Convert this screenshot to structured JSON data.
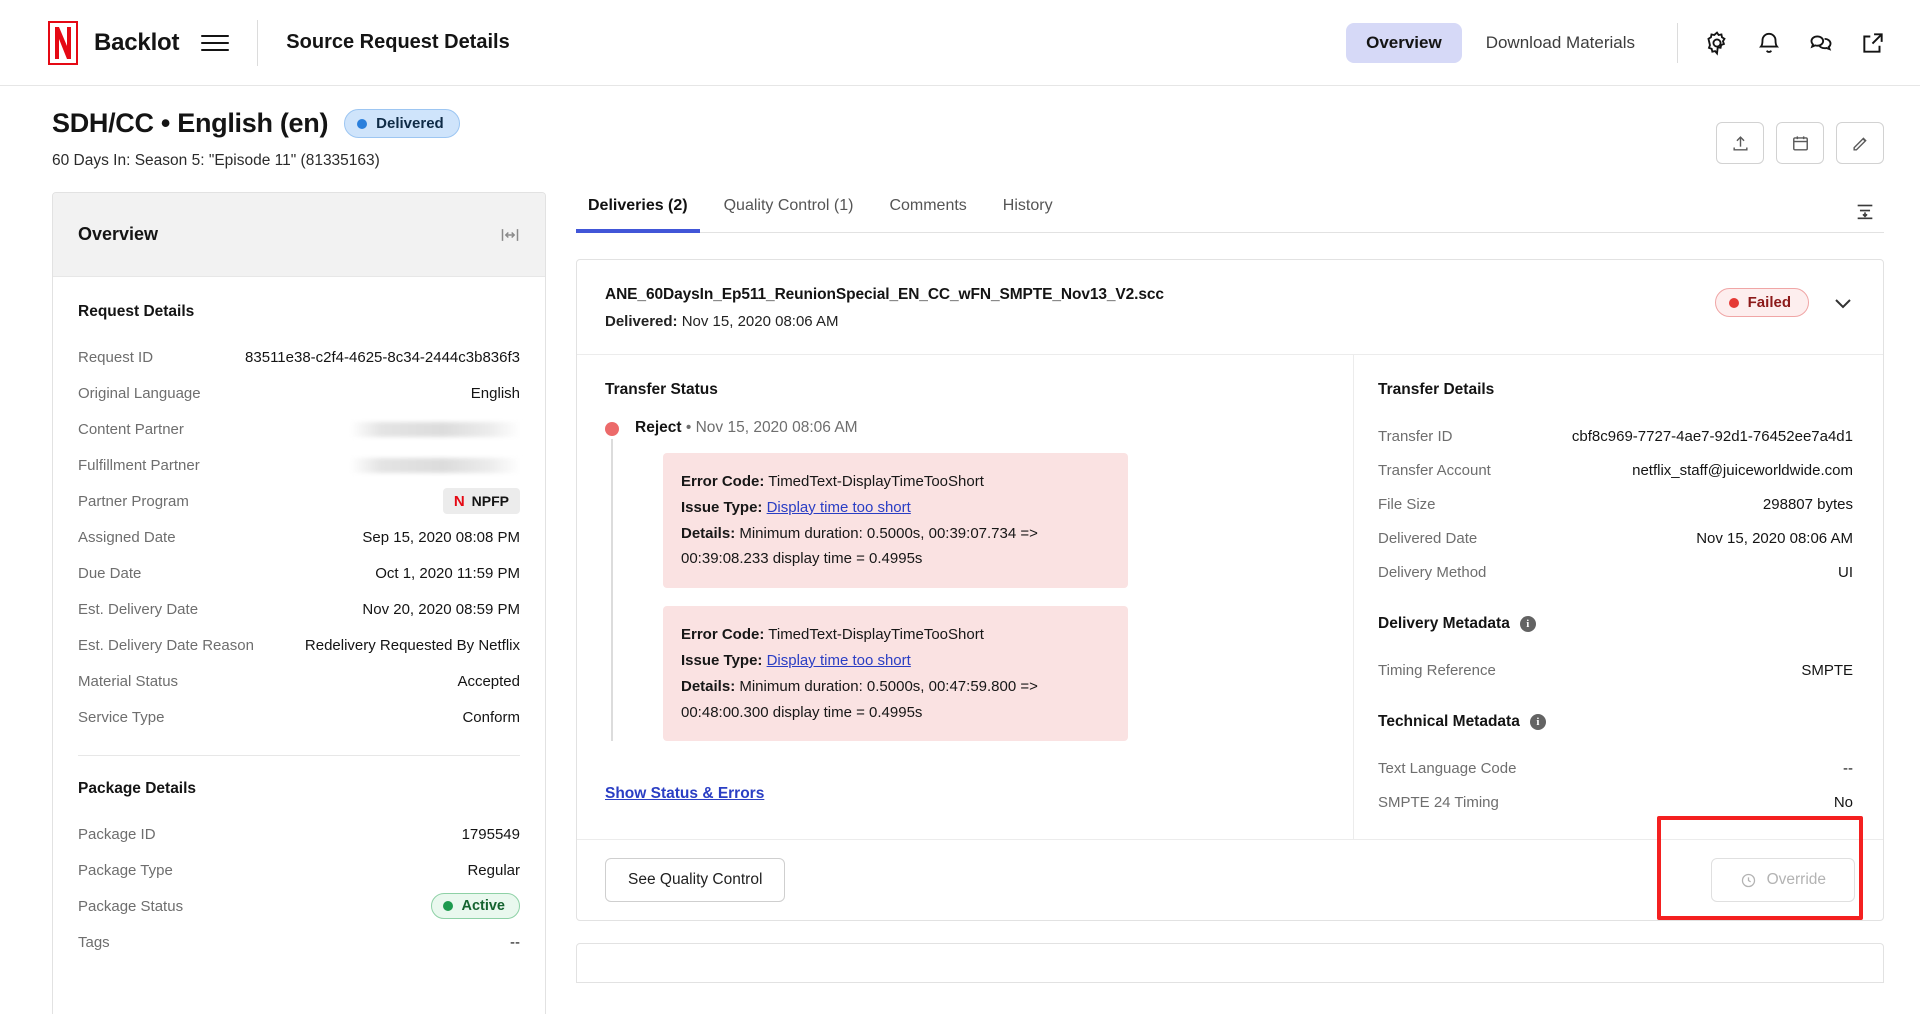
{
  "topnav": {
    "brand": "Backlot",
    "menu_icon": "hamburger-icon",
    "page_context": "Source Request Details",
    "nav_items": [
      {
        "label": "Overview",
        "active": true
      },
      {
        "label": "Download Materials",
        "active": false
      }
    ],
    "icons": [
      "gear-icon",
      "bell-icon",
      "chat-icon",
      "external-link-icon"
    ]
  },
  "page_header": {
    "title": "SDH/CC • English (en)",
    "status_badge": {
      "label": "Delivered",
      "color": "#2a7fdc"
    },
    "subtitle": "60 Days In: Season 5: \"Episode 11\"   (81335163)",
    "actions": [
      "upload-icon",
      "calendar-icon",
      "edit-icon"
    ]
  },
  "sidebar": {
    "header_title": "Overview",
    "collapse_icon": "collapse-panel-icon",
    "request_details": {
      "title": "Request Details",
      "rows": [
        {
          "label": "Request ID",
          "value": "83511e38-c2f4-4625-8c34-2444c3b836f3",
          "type": "text"
        },
        {
          "label": "Original Language",
          "value": "English",
          "type": "text"
        },
        {
          "label": "Content Partner",
          "value": "",
          "type": "redacted"
        },
        {
          "label": "Fulfillment Partner",
          "value": "",
          "type": "redacted"
        },
        {
          "label": "Partner Program",
          "value": "NPFP",
          "type": "chip-npfp"
        },
        {
          "label": "Assigned Date",
          "value": "Sep 15, 2020 08:08 PM",
          "type": "text"
        },
        {
          "label": "Due Date",
          "value": "Oct 1, 2020 11:59 PM",
          "type": "text"
        },
        {
          "label": "Est. Delivery Date",
          "value": "Nov 20, 2020 08:59 PM",
          "type": "text"
        },
        {
          "label": "Est. Delivery Date Reason",
          "value": "Redelivery Requested By Netflix",
          "type": "text"
        },
        {
          "label": "Material Status",
          "value": "Accepted",
          "type": "text"
        },
        {
          "label": "Service Type",
          "value": "Conform",
          "type": "text"
        }
      ]
    },
    "package_details": {
      "title": "Package Details",
      "rows": [
        {
          "label": "Package ID",
          "value": "1795549",
          "type": "text"
        },
        {
          "label": "Package Type",
          "value": "Regular",
          "type": "text"
        },
        {
          "label": "Package Status",
          "value": "Active",
          "type": "badge-active"
        },
        {
          "label": "Tags",
          "value": "--",
          "type": "text"
        }
      ]
    }
  },
  "content": {
    "tabs": [
      {
        "label": "Deliveries (2)",
        "active": true
      },
      {
        "label": "Quality Control (1)",
        "active": false
      },
      {
        "label": "Comments",
        "active": false
      },
      {
        "label": "History",
        "active": false
      }
    ],
    "filter_icon": "filter-sort-icon",
    "delivery_card": {
      "file_name": "ANE_60DaysIn_Ep511_ReunionSpecial_EN_CC_wFN_SMPTE_Nov13_V2.scc",
      "delivered_label": "Delivered:",
      "delivered_value": "Nov 15, 2020 08:06 AM",
      "status_badge": {
        "label": "Failed",
        "color": "#e53935"
      },
      "expand_icon": "chevron-down-icon",
      "transfer_status": {
        "title": "Transfer Status",
        "event_label": "Reject",
        "event_sep": "•",
        "event_time": "Nov 15, 2020 08:06 AM",
        "errors": [
          {
            "error_code_label": "Error Code:",
            "error_code": "TimedText-DisplayTimeTooShort",
            "issue_type_label": "Issue Type:",
            "issue_type": "Display time too short",
            "details_label": "Details:",
            "details": "Minimum duration: 0.5000s, 00:39:07.734 => 00:39:08.233 display time = 0.4995s"
          },
          {
            "error_code_label": "Error Code:",
            "error_code": "TimedText-DisplayTimeTooShort",
            "issue_type_label": "Issue Type:",
            "issue_type": "Display time too short",
            "details_label": "Details:",
            "details": "Minimum duration: 0.5000s, 00:47:59.800 => 00:48:00.300 display time = 0.4995s"
          }
        ],
        "show_status_link": "Show Status & Errors"
      },
      "transfer_details": {
        "title": "Transfer Details",
        "rows": [
          {
            "label": "Transfer ID",
            "value": "cbf8c969-7727-4ae7-92d1-76452ee7a4d1"
          },
          {
            "label": "Transfer Account",
            "value": "netflix_staff@juiceworldwide.com"
          },
          {
            "label": "File Size",
            "value": "298807 bytes"
          },
          {
            "label": "Delivered Date",
            "value": "Nov 15, 2020 08:06 AM"
          },
          {
            "label": "Delivery Method",
            "value": "UI"
          }
        ]
      },
      "delivery_metadata": {
        "title": "Delivery Metadata",
        "info_icon": "info-icon",
        "rows": [
          {
            "label": "Timing Reference",
            "value": "SMPTE"
          }
        ]
      },
      "technical_metadata": {
        "title": "Technical Metadata",
        "info_icon": "info-icon",
        "rows": [
          {
            "label": "Text Language Code",
            "value": "--"
          },
          {
            "label": "SMPTE 24 Timing",
            "value": "No"
          }
        ]
      },
      "footer": {
        "quality_control_button": "See Quality Control",
        "override_button": "Override",
        "override_icon": "clock-override-icon",
        "highlight_color": "#f42020"
      }
    }
  }
}
